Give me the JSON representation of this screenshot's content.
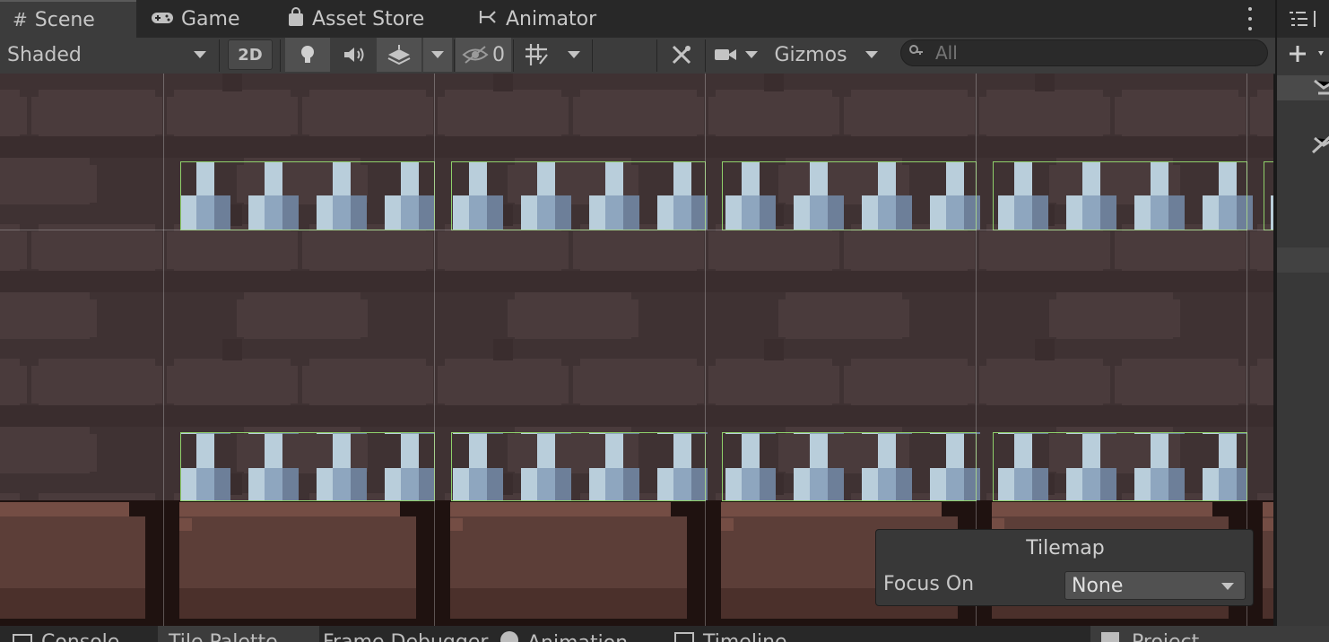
{
  "tabs": [
    {
      "label": "Scene",
      "icon": "hash-icon",
      "active": true
    },
    {
      "label": "Game",
      "icon": "gamepad-icon",
      "active": false
    },
    {
      "label": "Asset Store",
      "icon": "shopping-bag-icon",
      "active": false
    },
    {
      "label": "Animator",
      "icon": "animator-icon",
      "active": false
    }
  ],
  "toolbar": {
    "draw_mode": "Shaded",
    "mode_2d_label": "2D",
    "hidden_count": "0",
    "gizmos_label": "Gizmos"
  },
  "search": {
    "placeholder": "All"
  },
  "overlay": {
    "title": "Tilemap",
    "focus_label": "Focus On",
    "focus_value": "None"
  },
  "bottom_tabs": [
    "Console",
    "Tile Palette",
    "Frame Debugger",
    "Animation",
    "Timeline",
    "Project"
  ],
  "colors": {
    "wall_dark": "#3f3233",
    "wall_light": "#4a3b3c",
    "spike_light": "#b9cedb",
    "spike_mid": "#8ea6bf",
    "spike_dark": "#6d7f99",
    "ground": "#5c3e38",
    "ground_shadow": "#1f1210",
    "selection_green": "#8fd06a"
  }
}
